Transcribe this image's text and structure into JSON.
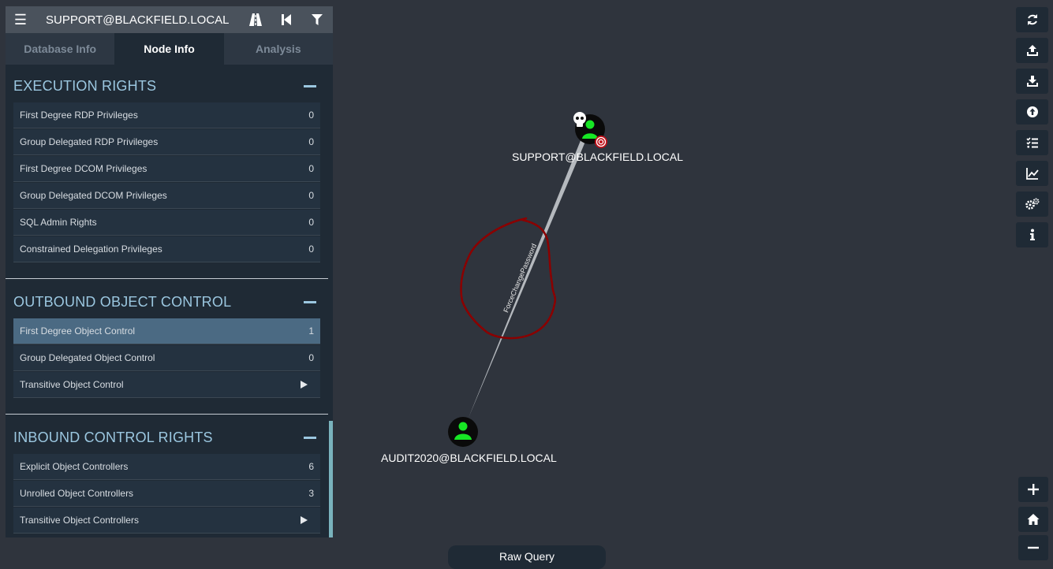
{
  "search": {
    "value": "SUPPORT@BLACKFIELD.LOCAL"
  },
  "toolbar": {
    "menu_icon": "hamburger-icon",
    "pathfinding_icon": "road-icon",
    "back_icon": "step-backward-icon",
    "filter_icon": "filter-icon"
  },
  "tabs": [
    {
      "label": "Database Info",
      "active": false
    },
    {
      "label": "Node Info",
      "active": true
    },
    {
      "label": "Analysis",
      "active": false
    }
  ],
  "sections": {
    "execution": {
      "title": "EXECUTION RIGHTS",
      "rows": [
        {
          "label": "First Degree RDP Privileges",
          "value": "0"
        },
        {
          "label": "Group Delegated RDP Privileges",
          "value": "0"
        },
        {
          "label": "First Degree DCOM Privileges",
          "value": "0"
        },
        {
          "label": "Group Delegated DCOM Privileges",
          "value": "0"
        },
        {
          "label": "SQL Admin Rights",
          "value": "0"
        },
        {
          "label": "Constrained Delegation Privileges",
          "value": "0"
        }
      ]
    },
    "outbound": {
      "title": "OUTBOUND OBJECT CONTROL",
      "rows": [
        {
          "label": "First Degree Object Control",
          "value": "1"
        },
        {
          "label": "Group Delegated Object Control",
          "value": "0"
        },
        {
          "label": "Transitive Object Control",
          "value": ""
        }
      ]
    },
    "inbound": {
      "title": "INBOUND CONTROL RIGHTS",
      "rows": [
        {
          "label": "Explicit Object Controllers",
          "value": "6"
        },
        {
          "label": "Unrolled Object Controllers",
          "value": "3"
        },
        {
          "label": "Transitive Object Controllers",
          "value": ""
        }
      ]
    }
  },
  "graph": {
    "nodes": {
      "support": {
        "label": "SUPPORT@BLACKFIELD.LOCAL",
        "owned": true,
        "high_value": true
      },
      "audit": {
        "label": "AUDIT2020@BLACKFIELD.LOCAL"
      }
    },
    "edge_label": "ForceChangePassword",
    "colors": {
      "user_node": "#17e625",
      "annotation": "#8b0000",
      "owned_target": "#c0101a"
    }
  },
  "right_toolbar": [
    "refresh-icon",
    "upload-icon",
    "download-icon",
    "upload-circle-icon",
    "tasks-icon",
    "line-chart-icon",
    "cogs-icon",
    "info-icon"
  ],
  "zoom": [
    "zoom-in-icon",
    "home-icon",
    "zoom-out-icon"
  ],
  "raw_query": {
    "label": "Raw Query"
  }
}
